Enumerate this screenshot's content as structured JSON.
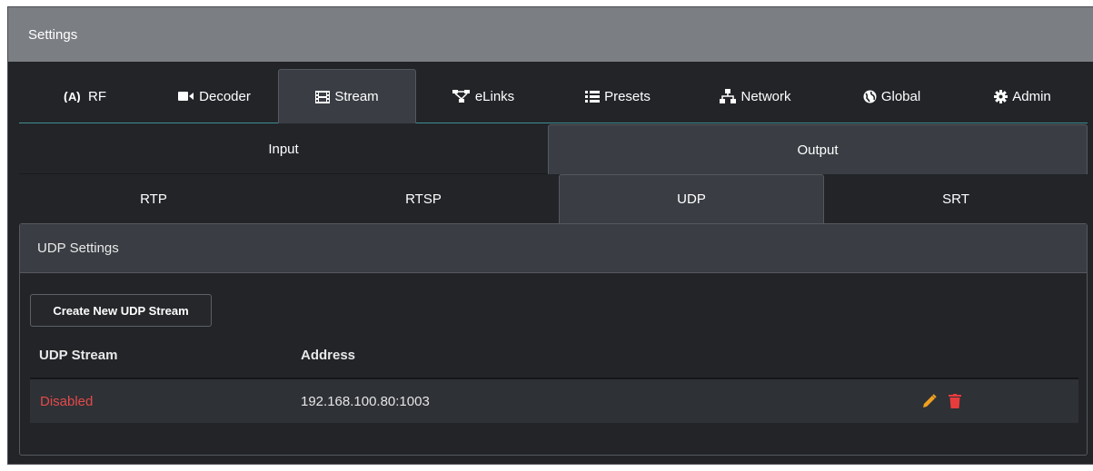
{
  "header": {
    "title": "Settings"
  },
  "main_tabs": [
    {
      "label": "RF",
      "icon": "rf-antenna-icon"
    },
    {
      "label": "Decoder",
      "icon": "video-camera-icon"
    },
    {
      "label": "Stream",
      "icon": "film-icon",
      "active": true
    },
    {
      "label": "eLinks",
      "icon": "network-links-icon"
    },
    {
      "label": "Presets",
      "icon": "list-icon"
    },
    {
      "label": "Network",
      "icon": "sitemap-icon"
    },
    {
      "label": "Global",
      "icon": "globe-icon"
    },
    {
      "label": "Admin",
      "icon": "gear-icon"
    }
  ],
  "io_tabs": [
    {
      "label": "Input"
    },
    {
      "label": "Output",
      "active": true
    }
  ],
  "protocol_tabs": [
    {
      "label": "RTP"
    },
    {
      "label": "RTSP"
    },
    {
      "label": "UDP",
      "active": true
    },
    {
      "label": "SRT"
    }
  ],
  "udp_panel": {
    "title": "UDP Settings",
    "create_button": "Create New UDP Stream",
    "columns": [
      "UDP Stream",
      "Address"
    ],
    "rows": [
      {
        "stream": "Disabled",
        "address": "192.168.100.80:1003"
      }
    ]
  },
  "colors": {
    "header_bg": "#7b7f84",
    "panel_bg": "#222428",
    "active_tab_bg": "#3a3e44",
    "disabled_text": "#e34a4a",
    "edit_icon": "#f0a020",
    "delete_icon": "#e83c3c",
    "tab_underline": "#3f8f96"
  }
}
